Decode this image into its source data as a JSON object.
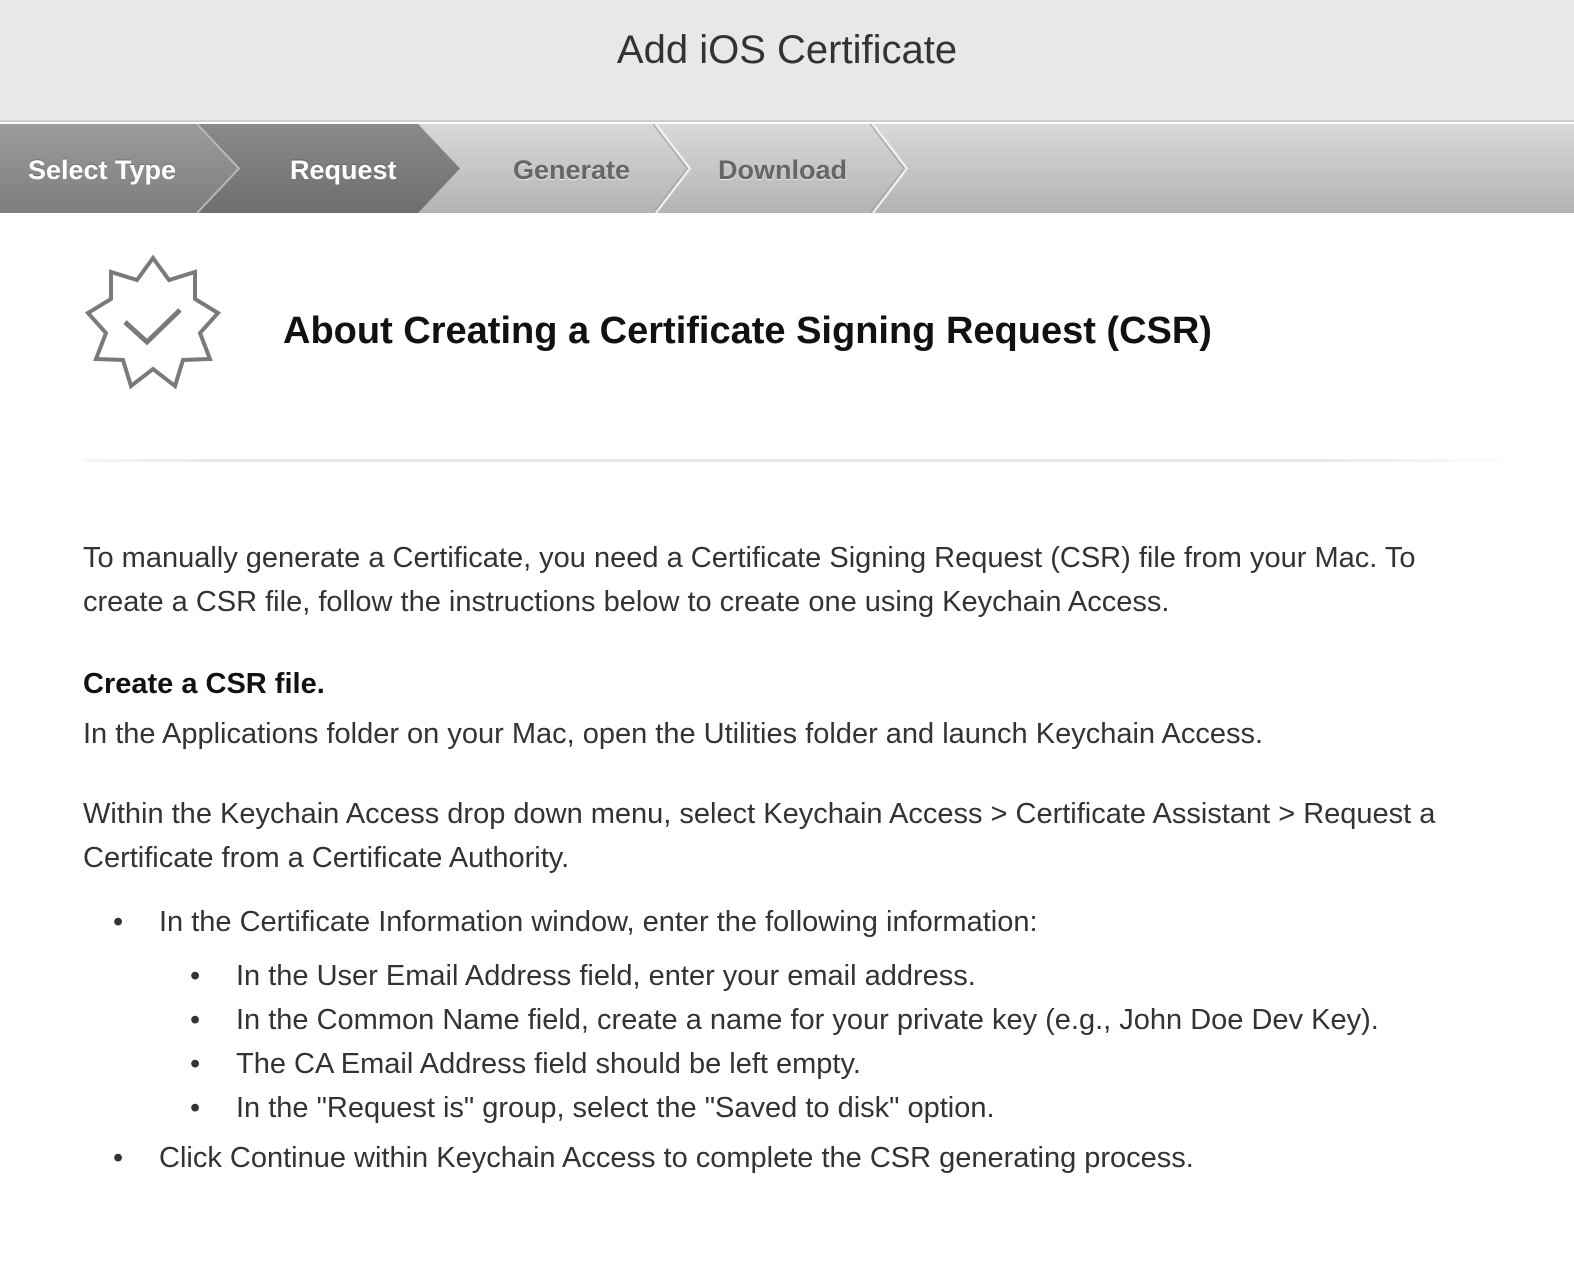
{
  "header": {
    "title": "Add iOS Certificate"
  },
  "steps": [
    {
      "label": "Select Type",
      "state": "completed"
    },
    {
      "label": "Request",
      "state": "current"
    },
    {
      "label": "Generate",
      "state": "upcoming"
    },
    {
      "label": "Download",
      "state": "upcoming"
    }
  ],
  "page": {
    "heading": "About Creating a Certificate Signing Request (CSR)",
    "badge_icon": "certificate-badge-check-icon",
    "intro": "To manually generate a Certificate, you need a Certificate Signing Request (CSR) file from your Mac. To create a CSR file, follow the instructions below to create one using Keychain Access.",
    "section_title": "Create a CSR file.",
    "step1": "In the Applications folder on your Mac, open the Utilities folder and launch Keychain Access.",
    "step2": "Within the Keychain Access drop down menu, select Keychain Access > Certificate Assistant > Request a Certificate from a Certificate Authority.",
    "bullets": [
      {
        "text": "In the Certificate Information window, enter the following information:",
        "sub": [
          "In the User Email Address field, enter your email address.",
          "In the Common Name field, create a name for your private key (e.g., John Doe Dev Key).",
          "The CA Email Address field should be left empty.",
          "In the \"Request is\" group, select the \"Saved to disk\" option."
        ]
      },
      {
        "text": "Click Continue within Keychain Access to complete the CSR generating process."
      }
    ]
  },
  "colors": {
    "step_completed": "#8a8a8a",
    "step_current": "#777777",
    "step_upcoming": "#c4c4c4",
    "header_bg": "#e8e8e8",
    "text": "#333333"
  }
}
